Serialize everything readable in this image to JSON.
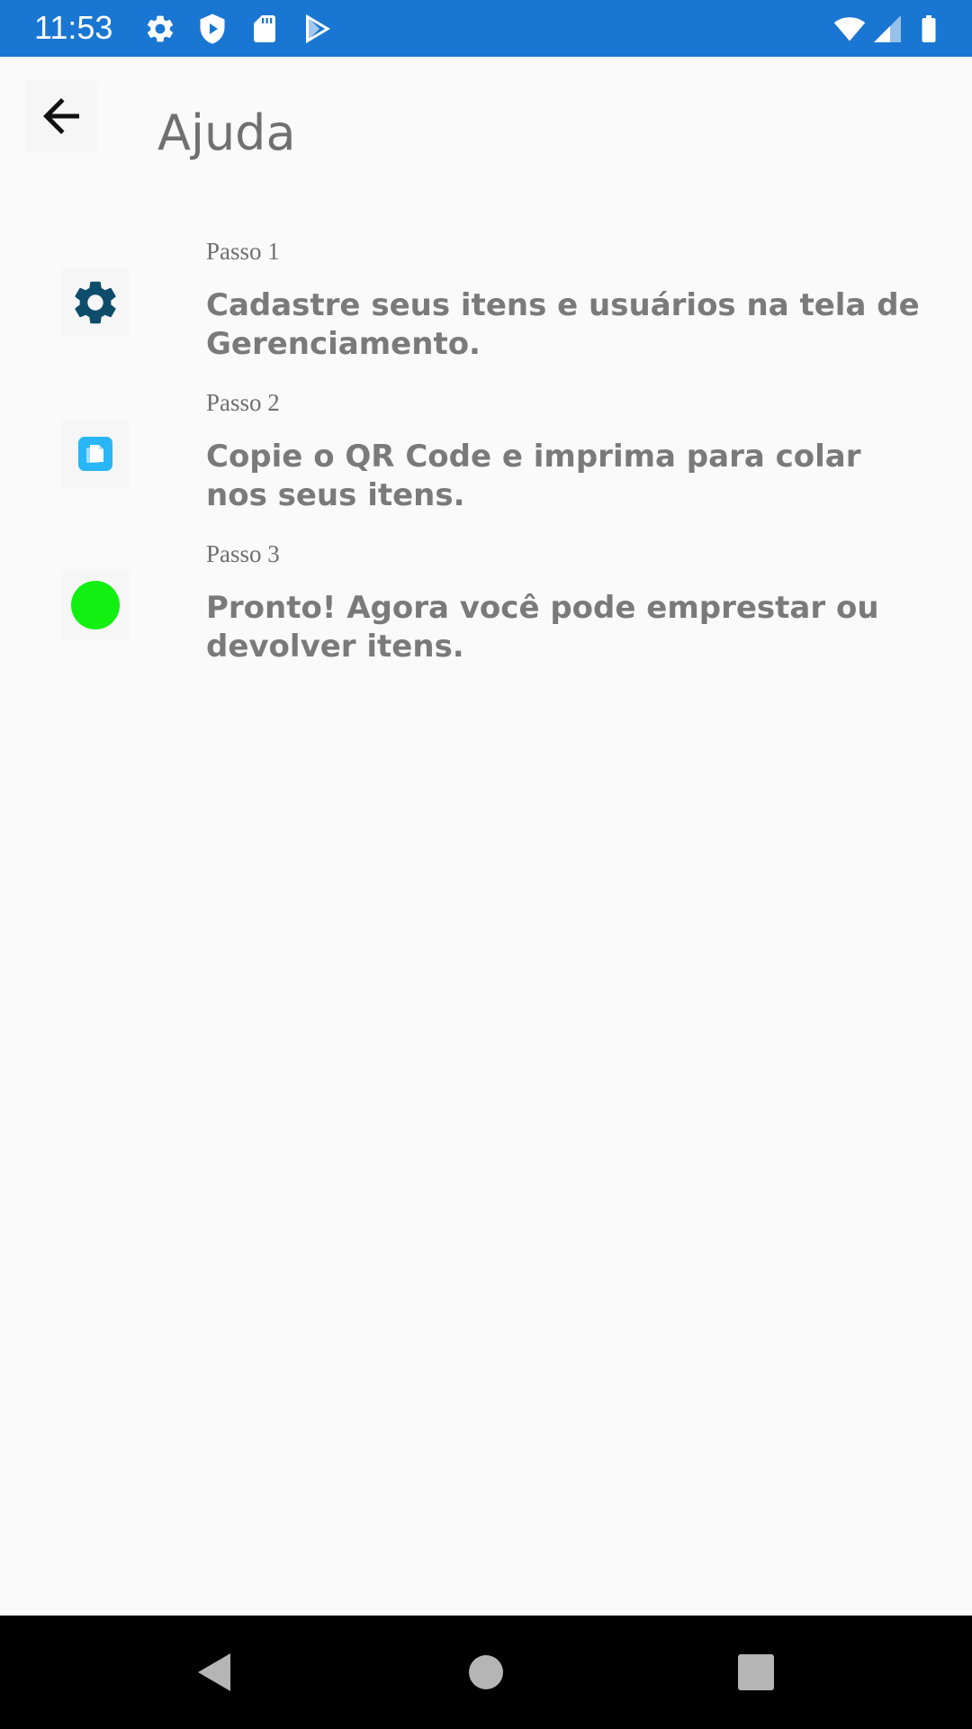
{
  "status_bar": {
    "time": "11:53",
    "background_color": "#1976d2",
    "left_icons": [
      "gear-icon",
      "shield-icon",
      "sd-card-icon",
      "play-store-icon"
    ],
    "right_icons": [
      "wifi-icon",
      "cell-signal-icon",
      "battery-icon"
    ]
  },
  "app_bar": {
    "back_icon": "arrow-back-icon",
    "title": "Ajuda"
  },
  "steps": [
    {
      "label": "Passo 1",
      "text": "Cadastre seus itens e usuários na tela de Gerenciamento.",
      "icon": "gear-icon",
      "icon_color": "#0d4d6b"
    },
    {
      "label": "Passo 2",
      "text": "Copie o QR Code e imprima para colar nos seus itens.",
      "icon": "copy-icon",
      "icon_color": "#29b6f6"
    },
    {
      "label": "Passo 3",
      "text": "Pronto! Agora você pode emprestar ou devolver itens.",
      "icon": "green-dot-icon",
      "icon_color": "#12f012"
    }
  ],
  "nav_bar": {
    "buttons": [
      "back-triangle-icon",
      "home-circle-icon",
      "recents-square-icon"
    ]
  }
}
